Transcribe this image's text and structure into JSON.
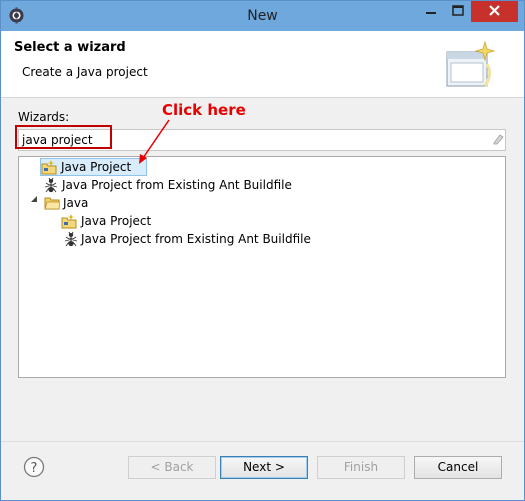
{
  "window": {
    "title": "New"
  },
  "header": {
    "title": "Select a wizard",
    "subtitle": "Create a Java project"
  },
  "wizards": {
    "label": "Wizards:",
    "search_value": "java project"
  },
  "annotation": {
    "text": "Click here",
    "color": "#e60000"
  },
  "tree": {
    "items": [
      {
        "label": "Java Project",
        "icon": "java-project-icon",
        "selected": true
      },
      {
        "label": "Java Project from Existing Ant Buildfile",
        "icon": "ant-icon"
      },
      {
        "label": "Java",
        "icon": "folder-icon",
        "expanded": true
      },
      {
        "label": "Java Project",
        "icon": "java-project-icon"
      },
      {
        "label": "Java Project from Existing Ant Buildfile",
        "icon": "ant-icon"
      }
    ]
  },
  "buttons": {
    "back": "< Back",
    "next": "Next >",
    "finish": "Finish",
    "cancel": "Cancel"
  }
}
